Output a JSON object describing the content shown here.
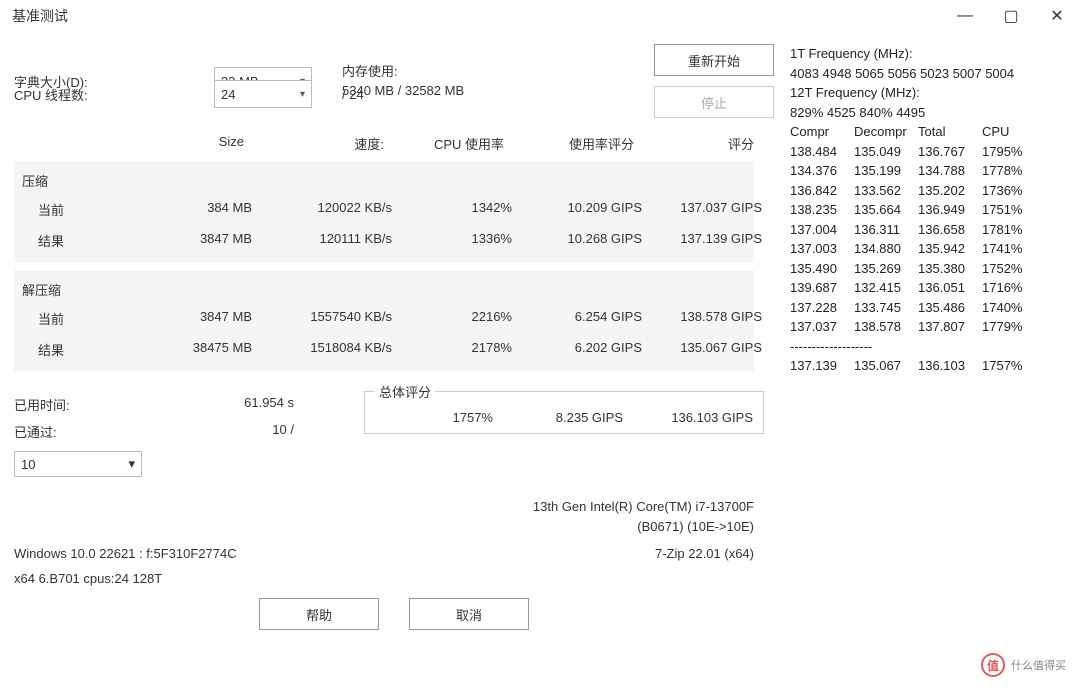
{
  "window": {
    "title": "基准测试"
  },
  "settings": {
    "dict_label": "字典大小(D):",
    "dict_value": "32 MB",
    "threads_label": "CPU 线程数:",
    "threads_value": "24",
    "threads_max": "/ 24",
    "mem_label": "内存使用:",
    "mem_value": "5340 MB / 32582 MB"
  },
  "buttons": {
    "restart": "重新开始",
    "stop": "停止",
    "help": "帮助",
    "cancel": "取消"
  },
  "table": {
    "headers": {
      "size": "Size",
      "speed": "速度:",
      "cpu_usage": "CPU 使用率",
      "usage_rating": "使用率评分",
      "rating": "评分"
    },
    "compress_label": "压缩",
    "decompress_label": "解压缩",
    "current_label": "当前",
    "result_label": "结果",
    "compress": {
      "current": {
        "size": "384 MB",
        "speed": "120022 KB/s",
        "cpu": "1342%",
        "usage_rating": "10.209 GIPS",
        "rating": "137.037 GIPS"
      },
      "result": {
        "size": "3847 MB",
        "speed": "120111 KB/s",
        "cpu": "1336%",
        "usage_rating": "10.268 GIPS",
        "rating": "137.139 GIPS"
      }
    },
    "decompress": {
      "current": {
        "size": "3847 MB",
        "speed": "1557540 KB/s",
        "cpu": "2216%",
        "usage_rating": "6.254 GIPS",
        "rating": "138.578 GIPS"
      },
      "result": {
        "size": "38475 MB",
        "speed": "1518084 KB/s",
        "cpu": "2178%",
        "usage_rating": "6.202 GIPS",
        "rating": "135.067 GIPS"
      }
    }
  },
  "status": {
    "elapsed_label": "已用时间:",
    "elapsed_value": "61.954 s",
    "passed_label": "已通过:",
    "passed_value": "10 /",
    "pass_select": "10"
  },
  "overall": {
    "label": "总体评分",
    "cpu": "1757%",
    "usage_rating": "8.235 GIPS",
    "rating": "136.103 GIPS"
  },
  "sys": {
    "cpu_name": "13th Gen Intel(R) Core(TM) i7-13700F",
    "cpu_code": "(B0671) (10E->10E)",
    "os": "Windows 10.0 22621 :  f:5F310F2774C",
    "app": "7-Zip 22.01 (x64)",
    "arch": "x64 6.B701 cpus:24 128T"
  },
  "right": {
    "freq1_label": "1T Frequency (MHz):",
    "freq1_values": " 4083 4948 5065 5056 5023 5007 5004",
    "freq12_label": "12T Frequency (MHz):",
    "freq12_values": " 829% 4525 840% 4495",
    "hdr": {
      "c": "Compr",
      "d": "Decompr",
      "t": "Total",
      "cpu": "CPU"
    },
    "rows": [
      {
        "c": "138.484",
        "d": "135.049",
        "t": "136.767",
        "cpu": "1795%"
      },
      {
        "c": "134.376",
        "d": "135.199",
        "t": "134.788",
        "cpu": "1778%"
      },
      {
        "c": "136.842",
        "d": "133.562",
        "t": "135.202",
        "cpu": "1736%"
      },
      {
        "c": "138.235",
        "d": "135.664",
        "t": "136.949",
        "cpu": "1751%"
      },
      {
        "c": "137.004",
        "d": "136.311",
        "t": "136.658",
        "cpu": "1781%"
      },
      {
        "c": "137.003",
        "d": "134.880",
        "t": "135.942",
        "cpu": "1741%"
      },
      {
        "c": "135.490",
        "d": "135.269",
        "t": "135.380",
        "cpu": "1752%"
      },
      {
        "c": "139.687",
        "d": "132.415",
        "t": "136.051",
        "cpu": "1716%"
      },
      {
        "c": "137.228",
        "d": "133.745",
        "t": "135.486",
        "cpu": "1740%"
      },
      {
        "c": "137.037",
        "d": "138.578",
        "t": "137.807",
        "cpu": "1779%"
      }
    ],
    "sep": "-------------------",
    "total": {
      "c": "137.139",
      "d": "135.067",
      "t": "136.103",
      "cpu": "1757%"
    }
  },
  "watermark": {
    "icon": "值",
    "text": "什么值得买"
  }
}
